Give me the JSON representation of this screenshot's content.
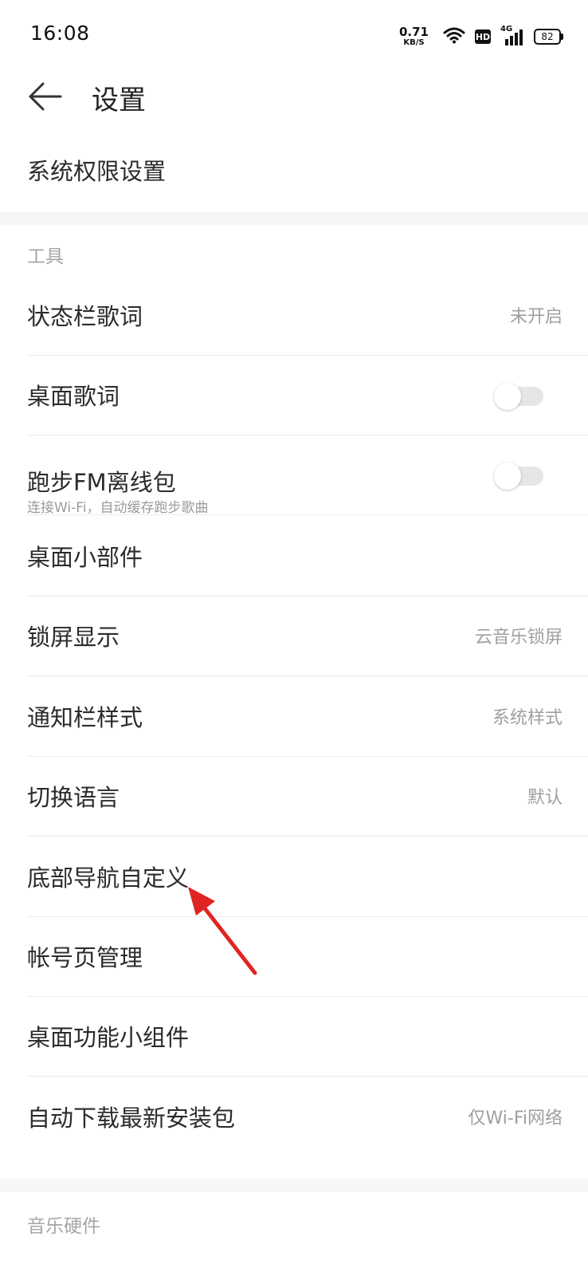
{
  "status_bar": {
    "time": "16:08",
    "net_speed_value": "0.71",
    "net_speed_unit": "KB/S",
    "hd_label": "HD",
    "signal_label": "4G",
    "battery": "82"
  },
  "header": {
    "title": "设置",
    "back_icon": "arrow-left-icon"
  },
  "top_section": {
    "items": [
      {
        "label": "系统权限设置"
      }
    ]
  },
  "tools": {
    "title": "工具",
    "items": [
      {
        "label": "状态栏歌词",
        "value": "未开启"
      },
      {
        "label": "桌面歌词",
        "toggle": false
      },
      {
        "label": "跑步FM离线包",
        "sub": "连接Wi-Fi，自动缓存跑步歌曲",
        "toggle": false
      },
      {
        "label": "桌面小部件"
      },
      {
        "label": "锁屏显示",
        "value": "云音乐锁屏"
      },
      {
        "label": "通知栏样式",
        "value": "系统样式"
      },
      {
        "label": "切换语言",
        "value": "默认"
      },
      {
        "label": "底部导航自定义"
      },
      {
        "label": "帐号页管理"
      },
      {
        "label": "桌面功能小组件"
      },
      {
        "label": "自动下载最新安装包",
        "value": "仅Wi-Fi网络"
      }
    ]
  },
  "music_hardware": {
    "title": "音乐硬件"
  },
  "colors": {
    "annotation_arrow": "#e02424",
    "background": "#f6f6f6",
    "card": "#ffffff",
    "secondary_text": "#9f9f9f"
  }
}
